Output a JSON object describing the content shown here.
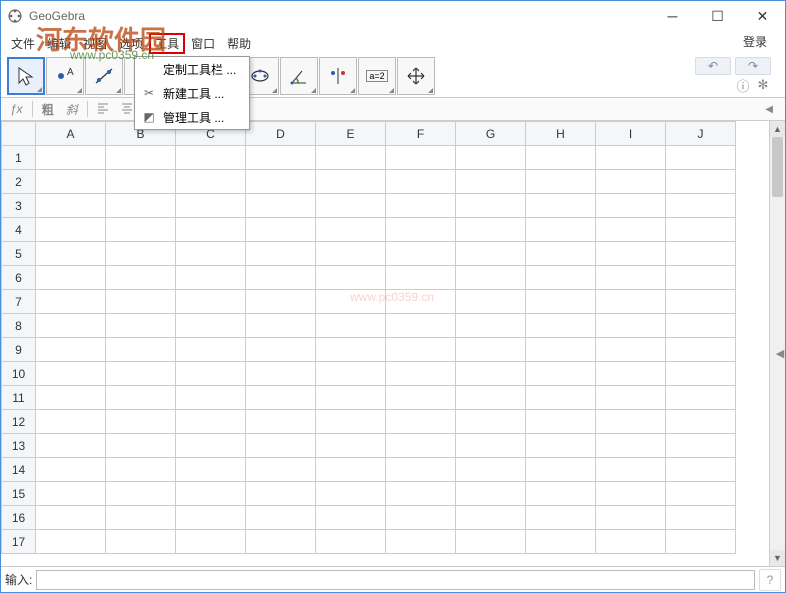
{
  "window": {
    "title": "GeoGebra"
  },
  "menu": {
    "file": "文件",
    "edit": "编辑",
    "view": "视图",
    "options": "选项",
    "tools": "工具",
    "window": "窗口",
    "help": "帮助",
    "login": "登录"
  },
  "dropdown": {
    "customize": "定制工具栏 ...",
    "newtool": "新建工具 ...",
    "manage": "管理工具 ..."
  },
  "toolbar": {
    "undo": "↶",
    "redo": "↷",
    "help": "?",
    "gear": "✻",
    "a2": "a=2"
  },
  "formatbar": {
    "fx": "ƒx",
    "bold": "粗",
    "italic": "斜"
  },
  "columns": [
    "A",
    "B",
    "C",
    "D",
    "E",
    "F",
    "G",
    "H",
    "I",
    "J"
  ],
  "rows": [
    "1",
    "2",
    "3",
    "4",
    "5",
    "6",
    "7",
    "8",
    "9",
    "10",
    "11",
    "12",
    "13",
    "14",
    "15",
    "16",
    "17"
  ],
  "input": {
    "label": "输入:"
  },
  "watermark": {
    "main": "河东软件园",
    "url": "www.pc0359.cn",
    "center": "www.pc0359.cn"
  }
}
